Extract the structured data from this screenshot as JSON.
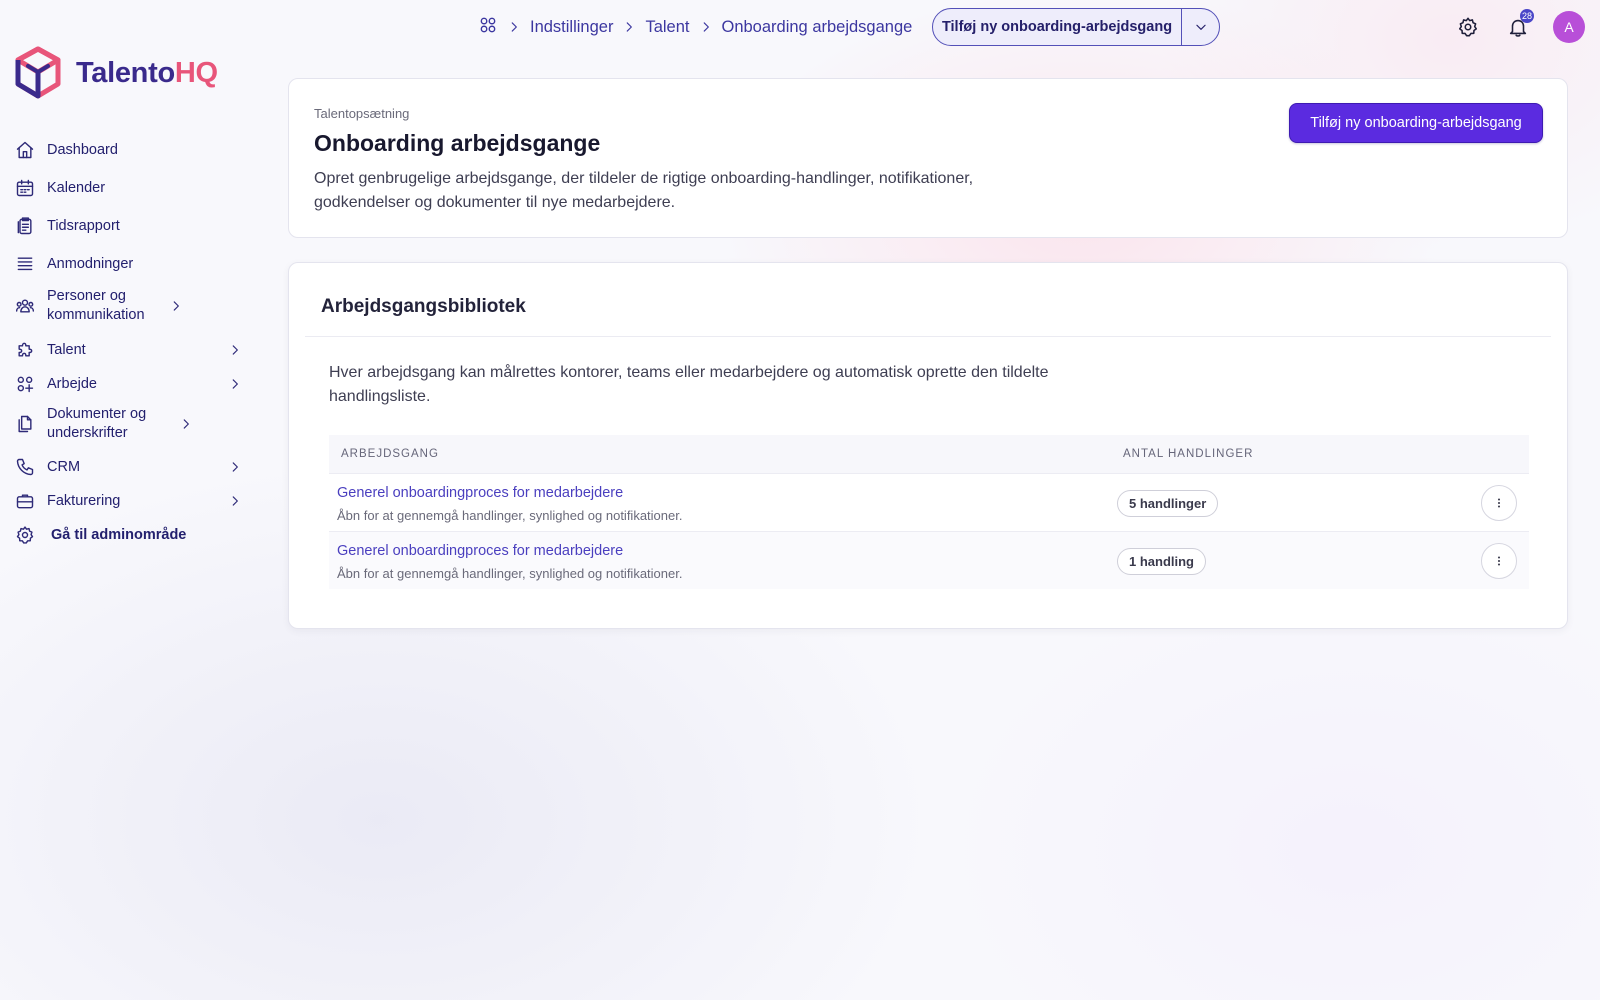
{
  "app": {
    "logo_part1": "Talento",
    "logo_part2": "HQ"
  },
  "sidebar": {
    "items": [
      {
        "label": "Dashboard",
        "icon": "home-icon",
        "has_chevron": false
      },
      {
        "label": "Kalender",
        "icon": "calendar-icon",
        "has_chevron": false
      },
      {
        "label": "Tidsrapport",
        "icon": "clipboard-icon",
        "has_chevron": false
      },
      {
        "label": "Anmodninger",
        "icon": "list-icon",
        "has_chevron": false
      },
      {
        "label": "Personer og kommunikation",
        "icon": "people-icon",
        "has_chevron": true
      },
      {
        "label": "Talent",
        "icon": "puzzle-icon",
        "has_chevron": true
      },
      {
        "label": "Arbejde",
        "icon": "grid-icon",
        "has_chevron": true
      },
      {
        "label": "Dokumenter og underskrifter",
        "icon": "documents-icon",
        "has_chevron": true
      },
      {
        "label": "CRM",
        "icon": "phone-icon",
        "has_chevron": true
      },
      {
        "label": "Fakturering",
        "icon": "briefcase-icon",
        "has_chevron": true
      },
      {
        "label": "Gå til adminområde",
        "icon": "gear-icon",
        "has_chevron": false
      }
    ]
  },
  "topbar": {
    "breadcrumb": [
      "Indstillinger",
      "Talent",
      "Onboarding arbejdsgange"
    ],
    "split_button_label": "Tilføj ny onboarding-arbejdsgang",
    "notification_count": "28",
    "avatar_initial": "A"
  },
  "header": {
    "eyebrow": "Talentopsætning",
    "title": "Onboarding arbejdsgange",
    "description": "Opret genbrugelige arbejdsgange, der tildeler de rigtige onboarding-handlinger, notifikationer, godkendelser og dokumenter til nye medarbejdere.",
    "primary_button": "Tilføj ny onboarding-arbejdsgang"
  },
  "library": {
    "title": "Arbejdsgangsbibliotek",
    "description": "Hver arbejdsgang kan målrettes kontorer, teams eller medarbejdere og automatisk oprette den tildelte handlingsliste.",
    "columns": [
      "ARBEJDSGANG",
      "ANTAL HANDLINGER"
    ],
    "rows": [
      {
        "name": "Generel onboardingproces for medarbejdere",
        "subtitle": "Åbn for at gennemgå handlinger, synlighed og notifikationer.",
        "count": "5 handlinger"
      },
      {
        "name": "Generel onboardingproces for medarbejdere",
        "subtitle": "Åbn for at gennemgå handlinger, synlighed og notifikationer.",
        "count": "1 handling"
      }
    ]
  },
  "colors": {
    "brand_dark": "#3a2a8c",
    "brand_accent": "#e8557a",
    "primary_button": "#5b2be0",
    "link": "#4a3fbf"
  }
}
